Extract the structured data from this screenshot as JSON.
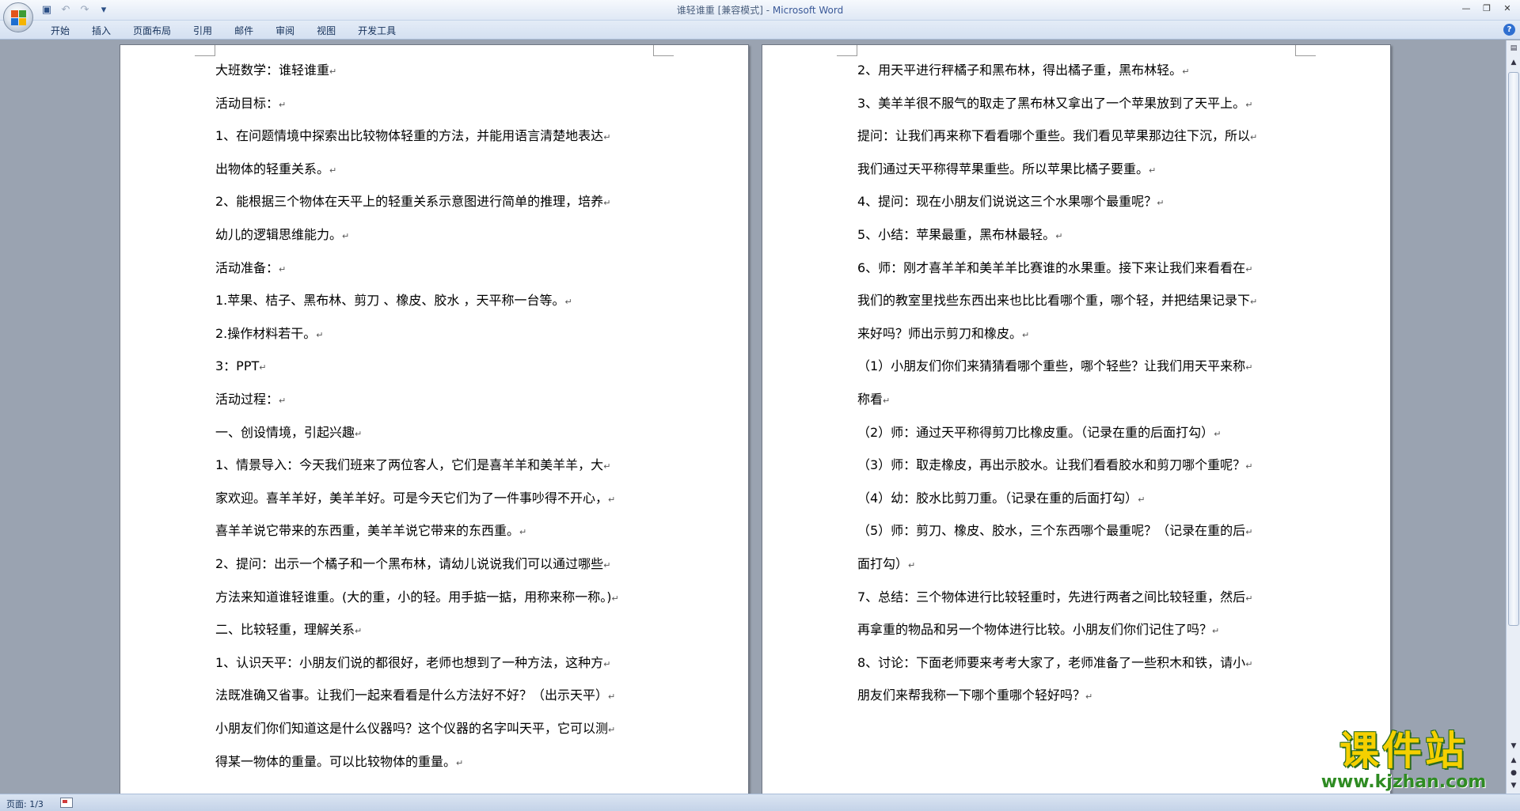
{
  "titlebar": {
    "title_doc": "谁轻谁重 [兼容模式] - ",
    "title_app": "Microsoft Word",
    "qat_icons": [
      "save-icon",
      "undo-icon",
      "redo-icon",
      "customize-qat-icon"
    ],
    "win_controls": [
      "minimize-icon",
      "restore-icon",
      "close-icon"
    ]
  },
  "ribbon": {
    "tabs": [
      "开始",
      "插入",
      "页面布局",
      "引用",
      "邮件",
      "审阅",
      "视图",
      "开发工具"
    ]
  },
  "left_page": {
    "paragraphs": [
      "大班数学：谁轻谁重",
      "活动目标：",
      "1、在问题情境中探索出比较物体轻重的方法，并能用语言清楚地表达",
      "出物体的轻重关系。",
      "2、能根据三个物体在天平上的轻重关系示意图进行简单的推理，培养",
      "幼儿的逻辑思维能力。",
      "活动准备：",
      "1.苹果、桔子、黑布林、剪刀 、橡皮、胶水 ，天平称一台等。",
      "2.操作材料若干。",
      "3：PPT",
      "活动过程：",
      "一、创设情境，引起兴趣",
      "1、情景导入：今天我们班来了两位客人，它们是喜羊羊和美羊羊，大",
      "家欢迎。喜羊羊好，美羊羊好。可是今天它们为了一件事吵得不开心，",
      "喜羊羊说它带来的东西重，美羊羊说它带来的东西重。",
      "2、提问：出示一个橘子和一个黑布林，请幼儿说说我们可以通过哪些",
      "方法来知道谁轻谁重。(大的重，小的轻。用手掂一掂，用称来称一称。)",
      "二、比较轻重，理解关系",
      "1、认识天平：小朋友们说的都很好，老师也想到了一种方法，这种方",
      "法既准确又省事。让我们一起来看看是什么方法好不好？（出示天平）",
      "小朋友们你们知道这是什么仪器吗？这个仪器的名字叫天平，它可以测",
      "得某一物体的重量。可以比较物体的重量。"
    ]
  },
  "right_page": {
    "paragraphs": [
      "2、用天平进行秤橘子和黑布林，得出橘子重，黑布林轻。",
      "3、美羊羊很不服气的取走了黑布林又拿出了一个苹果放到了天平上。",
      "提问：让我们再来称下看看哪个重些。我们看见苹果那边往下沉，所以",
      "我们通过天平称得苹果重些。所以苹果比橘子要重。",
      "4、提问：现在小朋友们说说这三个水果哪个最重呢？",
      "5、小结：苹果最重，黑布林最轻。",
      "6、师：刚才喜羊羊和美羊羊比赛谁的水果重。接下来让我们来看看在",
      "我们的教室里找些东西出来也比比看哪个重，哪个轻，并把结果记录下",
      "来好吗？师出示剪刀和橡皮。",
      "（1）小朋友们你们来猜猜看哪个重些，哪个轻些？让我们用天平来称",
      "称看",
      "（2）师：通过天平称得剪刀比橡皮重。（记录在重的后面打勾）",
      "（3）师：取走橡皮，再出示胶水。让我们看看胶水和剪刀哪个重呢？",
      "（4）幼：胶水比剪刀重。（记录在重的后面打勾）",
      "（5）师：剪刀、橡皮、胶水，三个东西哪个最重呢？（记录在重的后",
      "面打勾）",
      "7、总结：三个物体进行比较轻重时，先进行两者之间比较轻重，然后",
      "再拿重的物品和另一个物体进行比较。小朋友们你们记住了吗？",
      "8、讨论：下面老师要来考考大家了，老师准备了一些积木和铁，请小",
      "朋友们来帮我称一下哪个重哪个轻好吗？"
    ]
  },
  "paragraph_mark": "↵",
  "statusbar": {
    "page_count": "页面: 1/3"
  },
  "watermark": {
    "cn": "课件站",
    "url": "www.kjzhan.com"
  },
  "colors": {
    "office_logo": [
      "#e3541b",
      "#3f9c35",
      "#1e6fd0",
      "#f5b400"
    ],
    "watermark_yellow": "#f5d000",
    "watermark_green": "#2e8b22"
  }
}
